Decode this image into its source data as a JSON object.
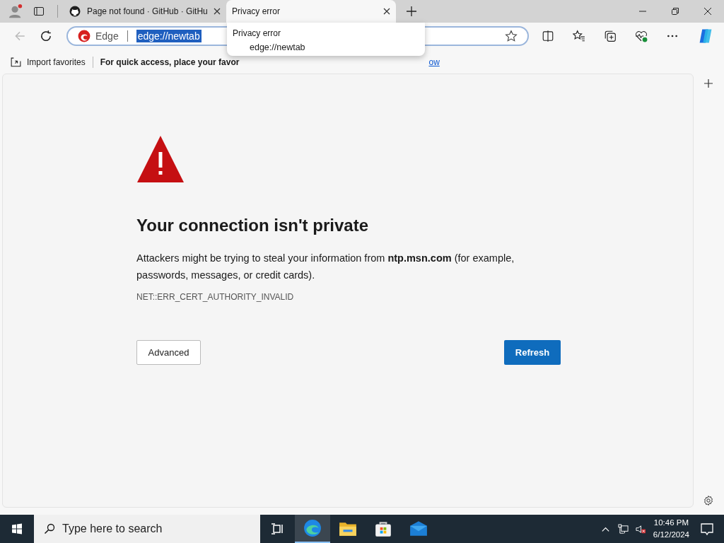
{
  "tabs": [
    {
      "title": "Page not found · GitHub · GitHu",
      "selected": false,
      "kind": "github"
    },
    {
      "title": "Privacy error",
      "selected": true,
      "kind": "page"
    }
  ],
  "address_bar": {
    "site_label": "Edge",
    "url": "edge://newtab",
    "selected_text": true
  },
  "tab_tooltip": {
    "title": "Privacy error",
    "url": "edge://newtab"
  },
  "favorites_bar": {
    "import_label": "Import favorites",
    "message": "For quick access, place your favor",
    "link": "ow"
  },
  "error_page": {
    "heading": "Your connection isn't private",
    "message": "Attackers might be trying to steal your information from **ntp.msn.com** (for example, passwords, messages, or credit cards).",
    "error_code": "NET::ERR_CERT_AUTHORITY_INVALID",
    "advanced_button": "Advanced",
    "refresh_button": "Refresh"
  },
  "taskbar": {
    "search_placeholder": "Type here to search",
    "time": "10:46 PM",
    "date": "6/12/2024"
  }
}
